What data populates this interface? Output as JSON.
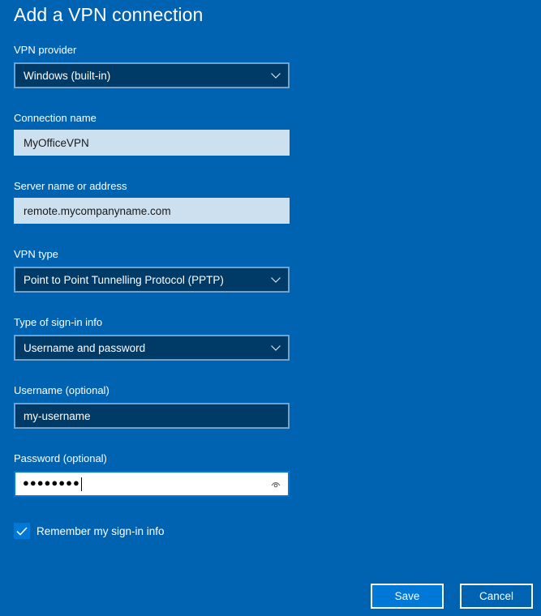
{
  "dialog": {
    "title": "Add a VPN connection"
  },
  "fields": {
    "vpn_provider": {
      "label": "VPN provider",
      "value": "Windows (built-in)"
    },
    "connection_name": {
      "label": "Connection name",
      "value": "MyOfficeVPN"
    },
    "server": {
      "label": "Server name or address",
      "value": "remote.mycompanyname.com"
    },
    "vpn_type": {
      "label": "VPN type",
      "value": "Point to Point Tunnelling Protocol (PPTP)"
    },
    "signin_type": {
      "label": "Type of sign-in info",
      "value": "Username and password"
    },
    "username": {
      "label": "Username (optional)",
      "value": "my-username"
    },
    "password": {
      "label": "Password (optional)",
      "value": "●●●●●●●●"
    }
  },
  "remember": {
    "label": "Remember my sign-in info",
    "checked": true
  },
  "buttons": {
    "save": "Save",
    "cancel": "Cancel"
  },
  "icons": {
    "dropdown": "chevron-down-icon",
    "reveal": "eye-icon",
    "check": "checkmark-icon"
  },
  "colors": {
    "background": "#0063b1",
    "accent": "#0078d7",
    "field_dark": "#003a66",
    "field_light": "#cce0f0"
  }
}
